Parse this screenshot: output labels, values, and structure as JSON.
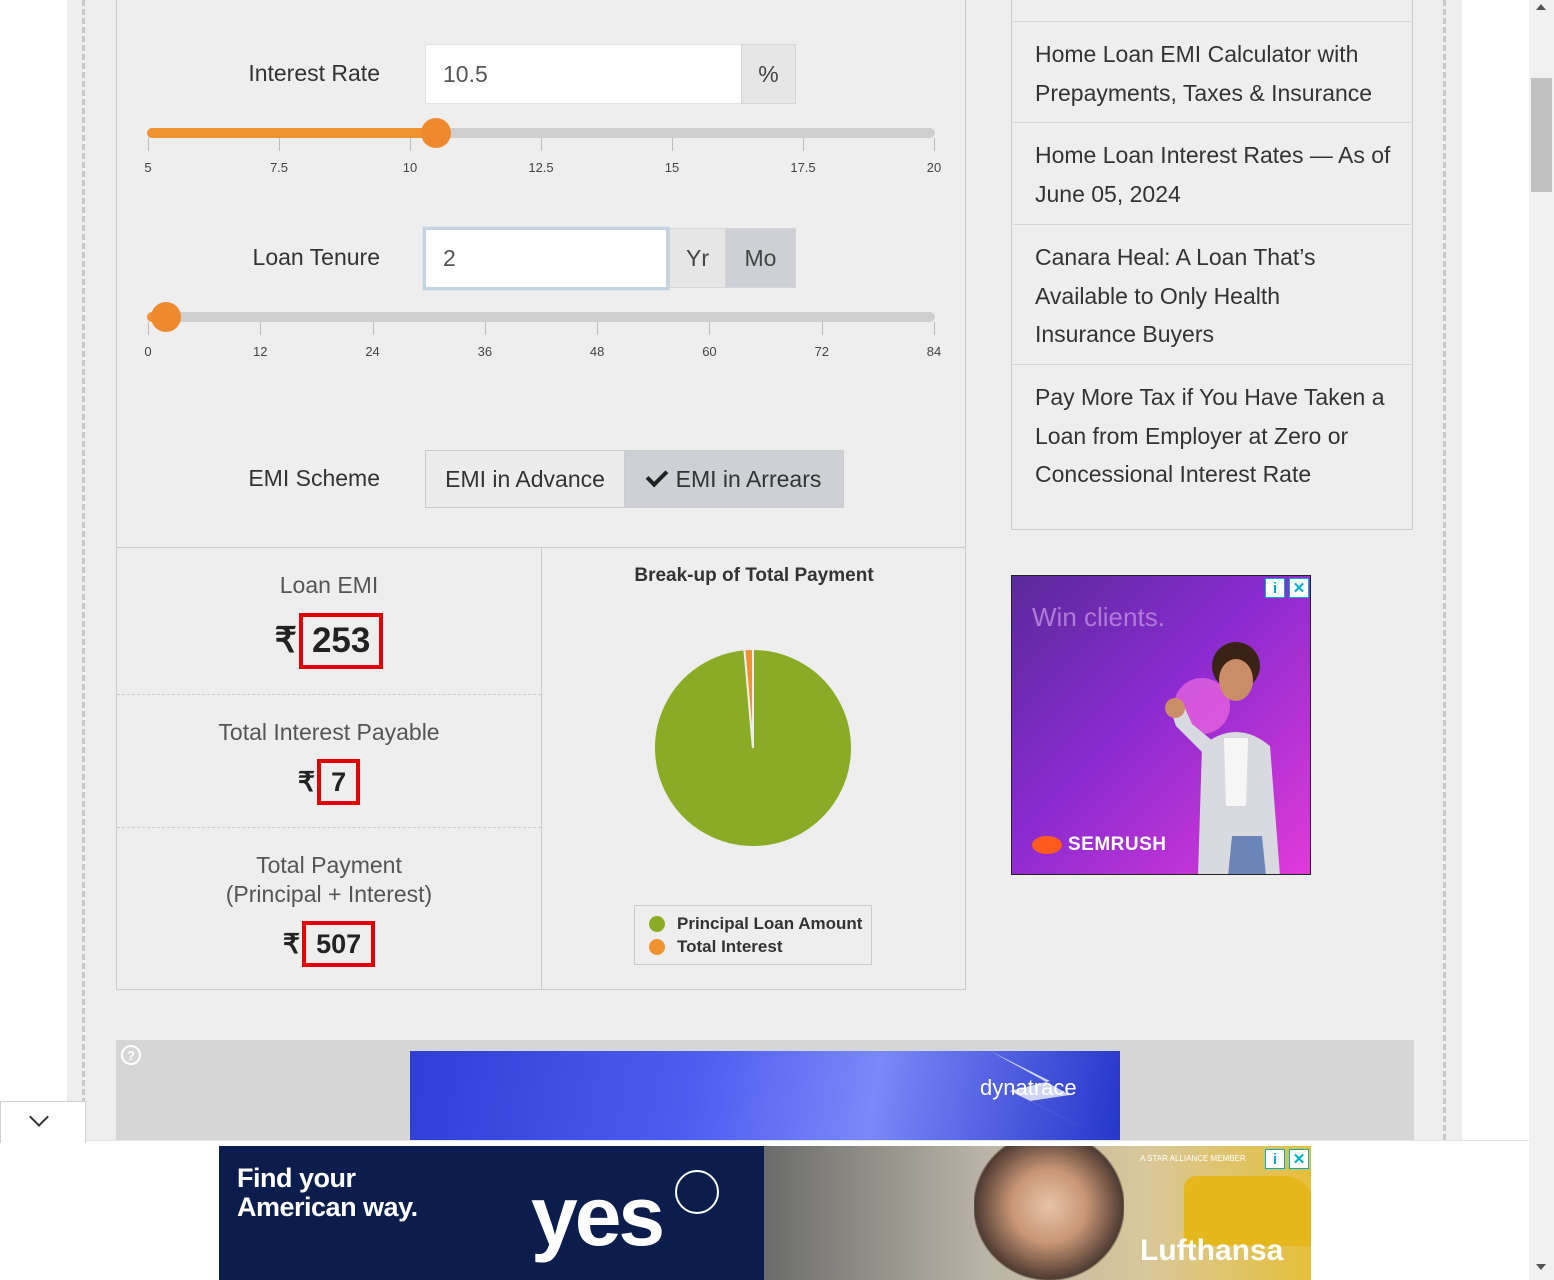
{
  "calculator": {
    "interest_rate": {
      "label": "Interest Rate",
      "value": "10.5",
      "unit": "%",
      "slider_min": 5,
      "slider_max": 20,
      "slider_value": 10.5,
      "ticks": [
        "5",
        "7.5",
        "10",
        "12.5",
        "15",
        "17.5",
        "20"
      ]
    },
    "loan_tenure": {
      "label": "Loan Tenure",
      "value": "2",
      "unit_year": "Yr",
      "unit_month": "Mo",
      "active_unit": "Mo",
      "slider_min": 0,
      "slider_max": 84,
      "slider_value": 2,
      "ticks": [
        "0",
        "12",
        "24",
        "36",
        "48",
        "60",
        "72",
        "84"
      ]
    },
    "emi_scheme": {
      "label": "EMI Scheme",
      "option_advance": "EMI in Advance",
      "option_arrears": "EMI in Arrears",
      "selected": "EMI in Arrears"
    }
  },
  "results": {
    "currency_symbol": "₹",
    "loan_emi": {
      "label": "Loan EMI",
      "value": "253"
    },
    "total_interest": {
      "label": "Total Interest Payable",
      "value": "7"
    },
    "total_payment": {
      "label_line1": "Total Payment",
      "label_line2": "(Principal + Interest)",
      "value": "507"
    }
  },
  "chart_data": {
    "type": "pie",
    "title": "Break-up of Total Payment",
    "labels": [
      "Principal Loan Amount",
      "Total Interest"
    ],
    "values": [
      500,
      7
    ],
    "colors": [
      "#8aab25",
      "#f0922f"
    ],
    "legend_position": "bottom"
  },
  "sidebar": {
    "articles": [
      {
        "title": "Home Loan EMI Calculator with Prepayments, Taxes & Insurance",
        "lines": [
          "Home Loan EMI Calculator with",
          "Prepayments, Taxes & Insurance"
        ]
      },
      {
        "title": "Home Loan Interest Rates — As of June 05, 2024",
        "lines": [
          "Home Loan Interest Rates — As of",
          "June 05, 2024"
        ]
      },
      {
        "title": "Canara Heal: A Loan That’s Available to Only Health Insurance Buyers",
        "lines": [
          "Canara Heal: A Loan That’s",
          "Available to Only Health",
          "Insurance Buyers"
        ]
      },
      {
        "title": "Pay More Tax if You Have Taken a Loan from Employer at Zero or Concessional Interest Rate",
        "lines": [
          "Pay More Tax if You Have Taken a",
          "Loan from Employer at Zero or",
          "Concessional Interest Rate"
        ]
      }
    ]
  },
  "ads": {
    "semrush": {
      "tagline": "Win clients.",
      "brand": "SEMRUSH"
    },
    "dynatrace": {
      "brand": "dynatrace"
    },
    "lufthansa": {
      "headline_line1": "Find your",
      "headline_line2": "American way.",
      "word": "yes",
      "brand": "Lufthansa",
      "note": "A STAR ALLIANCE MEMBER"
    },
    "info_icon": "i",
    "close_icon": "✕",
    "help_icon": "?"
  }
}
